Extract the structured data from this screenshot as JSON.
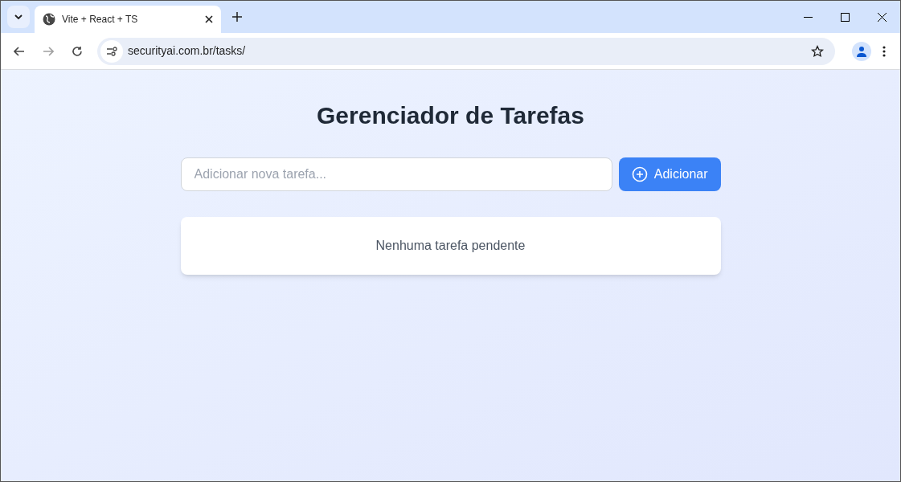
{
  "browser": {
    "tabs": [
      {
        "title": "Vite + React + TS",
        "selected": true
      }
    ],
    "address": "securityai.com.br/tasks/"
  },
  "page": {
    "title": "Gerenciador de Tarefas",
    "new_task": {
      "placeholder": "Adicionar nova tarefa..."
    },
    "add_button": "Adicionar",
    "empty_message": "Nenhuma tarefa pendente"
  }
}
